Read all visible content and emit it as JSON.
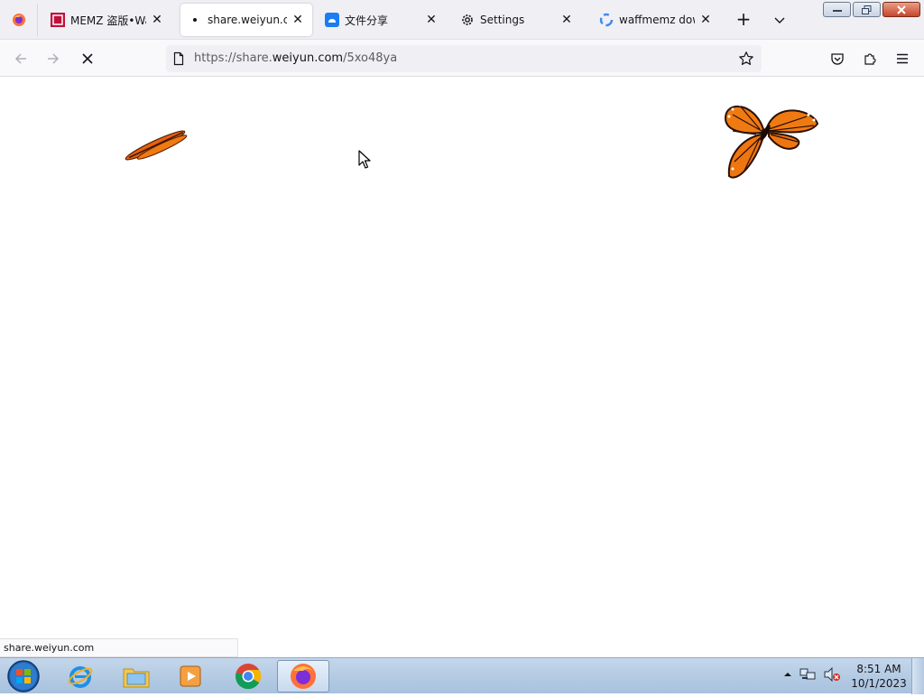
{
  "browser": {
    "tabs": [
      {
        "title": "MEMZ 盗版•Waffl",
        "favicon": "memz-icon",
        "active": false
      },
      {
        "title": "share.weiyun.com",
        "favicon": "loading-dot-icon",
        "active": true
      },
      {
        "title": "文件分享",
        "favicon": "weiyun-cloud-icon",
        "active": false
      },
      {
        "title": "Settings",
        "favicon": "gear-icon",
        "active": false
      },
      {
        "title": "waffmemz dow -",
        "favicon": "google-icon",
        "active": false
      }
    ],
    "url": {
      "prefix": "https://share.",
      "host": "weiyun.com",
      "path": "/5xo48ya"
    },
    "status_text": "share.weiyun.com"
  },
  "taskbar": {
    "apps": [
      "internet-explorer-icon",
      "file-explorer-icon",
      "media-player-icon",
      "chrome-icon",
      "firefox-icon"
    ],
    "clock_time": "8:51 AM",
    "clock_date": "10/1/2023"
  },
  "colors": {
    "accent": "#0060df",
    "butterfly": "#f07a12"
  }
}
